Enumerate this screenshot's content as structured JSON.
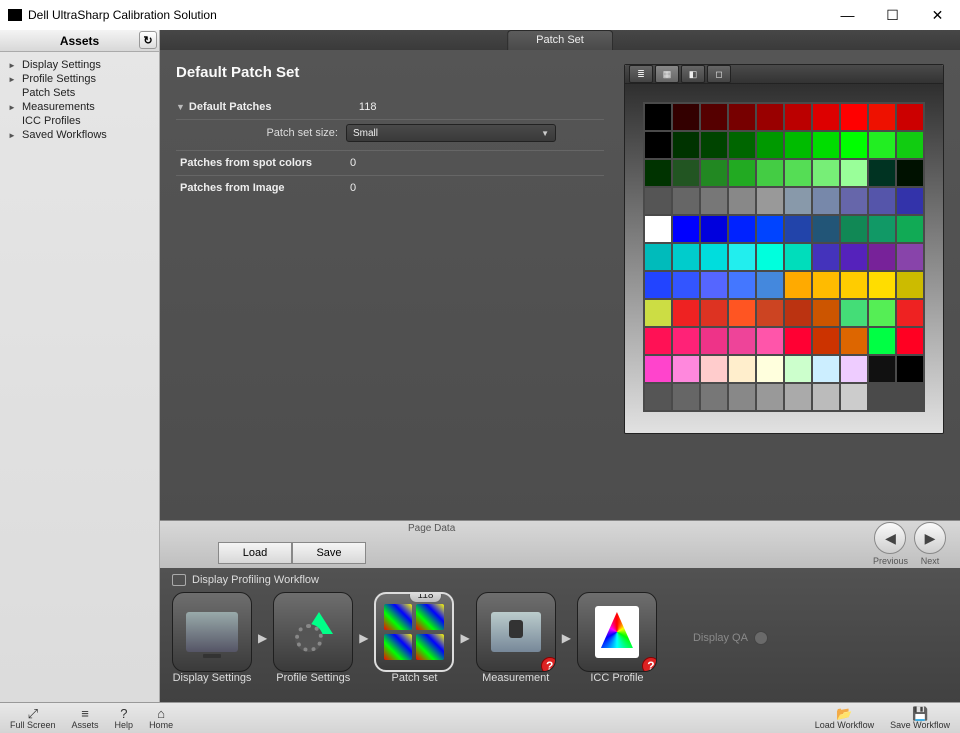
{
  "window": {
    "title": "Dell UltraSharp Calibration Solution"
  },
  "sidebar": {
    "header": "Assets",
    "items": [
      {
        "label": "Display Settings",
        "expandable": true
      },
      {
        "label": "Profile Settings",
        "expandable": true
      },
      {
        "label": "Patch Sets",
        "expandable": false
      },
      {
        "label": "Measurements",
        "expandable": true
      },
      {
        "label": "ICC Profiles",
        "expandable": false
      },
      {
        "label": "Saved Workflows",
        "expandable": true
      }
    ]
  },
  "tab": {
    "label": "Patch Set"
  },
  "panel": {
    "title": "Default Patch Set",
    "default_patches_label": "Default Patches",
    "default_patches_value": "118",
    "patch_set_size_label": "Patch set size:",
    "patch_set_size_value": "Small",
    "spot_label": "Patches from spot colors",
    "spot_value": "0",
    "image_label": "Patches from Image",
    "image_value": "0"
  },
  "pagedata": {
    "caption": "Page Data",
    "load": "Load",
    "save": "Save",
    "prev": "Previous",
    "next": "Next"
  },
  "workflow": {
    "title": "Display Profiling Workflow",
    "steps": [
      {
        "label": "Display Settings"
      },
      {
        "label": "Profile Settings"
      },
      {
        "label": "Patch set",
        "badge": "118"
      },
      {
        "label": "Measurement",
        "warn": true
      },
      {
        "label": "ICC Profile",
        "warn": true
      }
    ],
    "extra": "Display QA"
  },
  "bottombar": {
    "fullscreen": "Full Screen",
    "assets": "Assets",
    "help": "Help",
    "home": "Home",
    "load_wf": "Load Workflow",
    "save_wf": "Save Workflow"
  },
  "patch_colors": [
    "#000000",
    "#330000",
    "#550000",
    "#770000",
    "#990000",
    "#bb0000",
    "#dd0000",
    "#ff0000",
    "#ee1100",
    "#cc0000",
    "#000000",
    "#003300",
    "#004400",
    "#006600",
    "#009900",
    "#00bb00",
    "#00dd00",
    "#00ff00",
    "#22ee22",
    "#11cc11",
    "#003300",
    "#225522",
    "#228822",
    "#22aa22",
    "#44cc44",
    "#55dd55",
    "#77ee77",
    "#99ff99",
    "#003322",
    "#001100",
    "#555555",
    "#666666",
    "#777777",
    "#888888",
    "#999999",
    "#8899aa",
    "#7788aa",
    "#6666aa",
    "#5555aa",
    "#3333aa",
    "#ffffff",
    "#0000ff",
    "#0000dd",
    "#0022ff",
    "#0044ff",
    "#2244aa",
    "#225577",
    "#118855",
    "#119966",
    "#11aa55",
    "#00bbbb",
    "#00cccc",
    "#00dddd",
    "#22eeee",
    "#00ffdd",
    "#00ddbb",
    "#4433bb",
    "#5522bb",
    "#772299",
    "#8844aa",
    "#2244ff",
    "#3355ff",
    "#5566ff",
    "#4477ff",
    "#4488dd",
    "#ffaa00",
    "#ffbb00",
    "#ffcc00",
    "#ffdd00",
    "#ccbb00",
    "#ccdd44",
    "#ee2222",
    "#dd3322",
    "#ff5522",
    "#cc4422",
    "#bb3311",
    "#cc5500",
    "#44dd77",
    "#55ee55",
    "#ee2222",
    "#ff1155",
    "#ff2277",
    "#ee3388",
    "#ee4499",
    "#ff55aa",
    "#ff0033",
    "#cc3300",
    "#dd6600",
    "#00ff44",
    "#ff0022",
    "#ff44cc",
    "#ff88dd",
    "#ffcccc",
    "#ffeecc",
    "#ffffdd",
    "#ccffcc",
    "#cceeff",
    "#eeccff",
    "#111111",
    "#000000",
    "#555555",
    "#666666",
    "#777777",
    "#888888",
    "#999999",
    "#aaaaaa",
    "#bbbbbb",
    "#cccccc"
  ]
}
